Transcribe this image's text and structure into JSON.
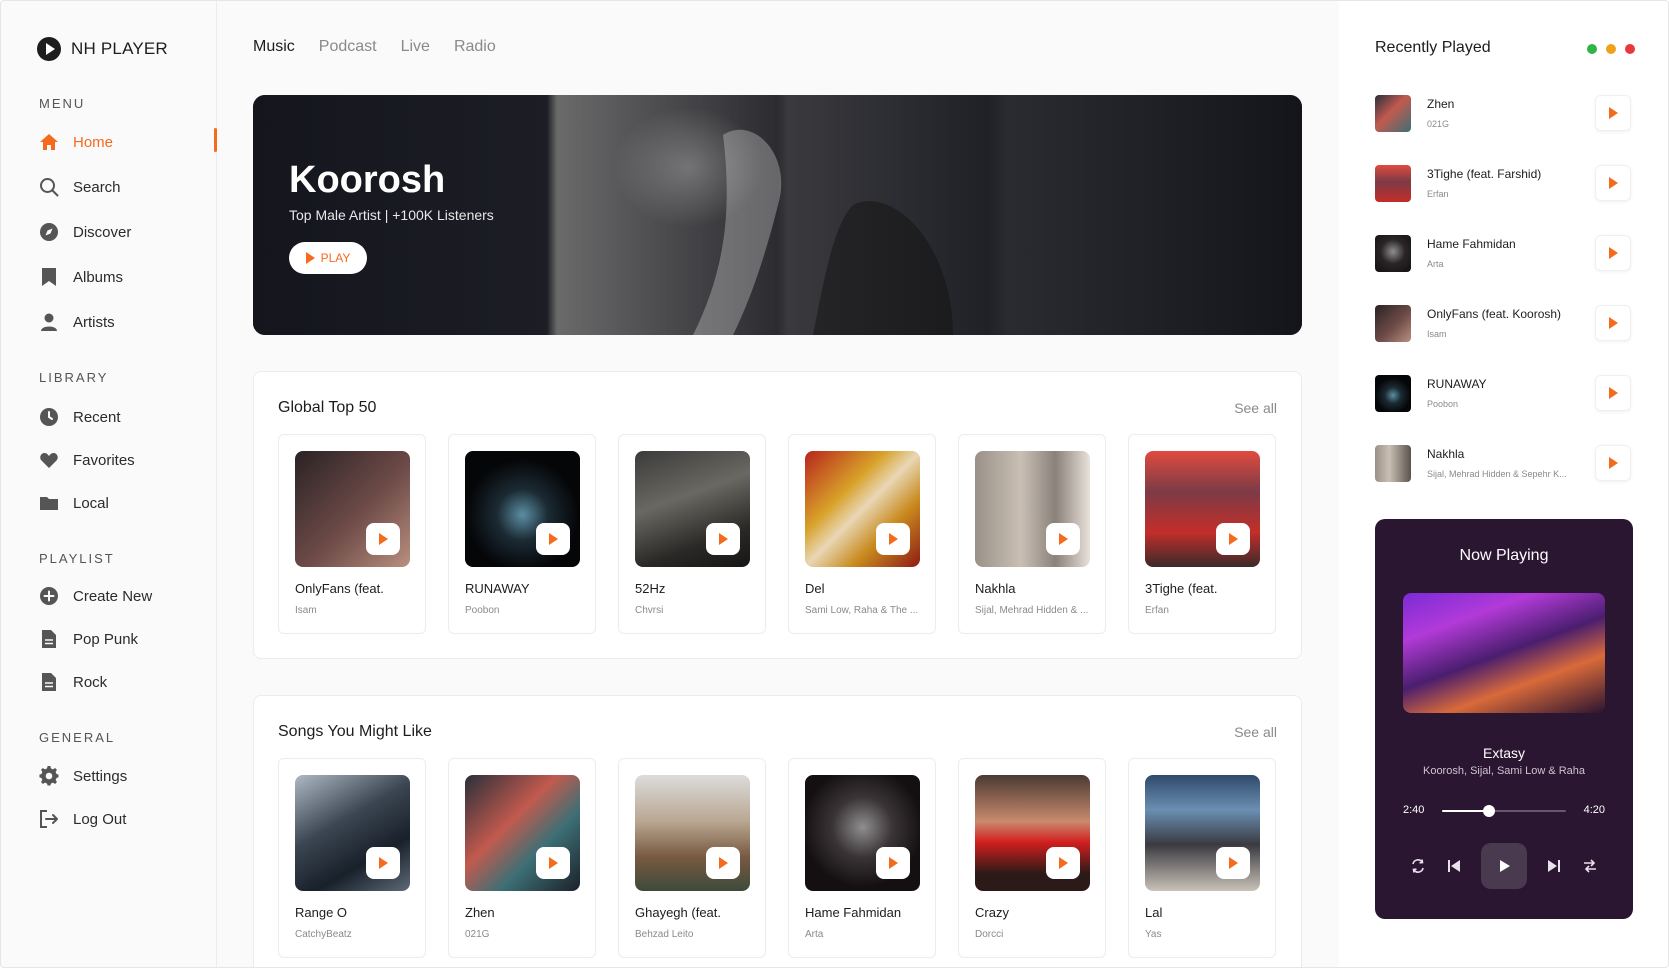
{
  "app": {
    "name": "NH PLAYER"
  },
  "sidebar": {
    "sections": {
      "menu": "MENU",
      "library": "LIBRARY",
      "playlist": "PLAYLIST",
      "general": "GENERAL"
    },
    "menu_items": [
      {
        "label": "Home",
        "icon": "home-icon",
        "active": true
      },
      {
        "label": "Search",
        "icon": "search-icon"
      },
      {
        "label": "Discover",
        "icon": "compass-icon"
      },
      {
        "label": "Albums",
        "icon": "bookmark-icon"
      },
      {
        "label": "Artists",
        "icon": "user-icon"
      }
    ],
    "library_items": [
      {
        "label": "Recent",
        "icon": "clock-icon"
      },
      {
        "label": "Favorites",
        "icon": "heart-icon"
      },
      {
        "label": "Local",
        "icon": "folder-icon"
      }
    ],
    "playlist_items": [
      {
        "label": "Create New",
        "icon": "plus-circle-icon"
      },
      {
        "label": "Pop Punk",
        "icon": "document-icon"
      },
      {
        "label": "Rock",
        "icon": "document-icon"
      }
    ],
    "general_items": [
      {
        "label": "Settings",
        "icon": "gear-icon"
      },
      {
        "label": "Log Out",
        "icon": "logout-icon"
      }
    ]
  },
  "header": {
    "tabs": [
      {
        "label": "Music",
        "active": true
      },
      {
        "label": "Podcast"
      },
      {
        "label": "Live"
      },
      {
        "label": "Radio"
      }
    ]
  },
  "hero": {
    "title": "Koorosh",
    "subtitle": "Top Male Artist | +100K Listeners",
    "play_label": "PLAY"
  },
  "global_top": {
    "title": "Global Top 50",
    "see_all": "See all",
    "items": [
      {
        "title": "OnlyFans (feat.",
        "artist": "Isam"
      },
      {
        "title": "RUNAWAY",
        "artist": "Poobon"
      },
      {
        "title": "52Hz",
        "artist": "Chvrsi"
      },
      {
        "title": "Del",
        "artist": "Sami Low, Raha & The ..."
      },
      {
        "title": "Nakhla",
        "artist": "Sijal, Mehrad Hidden & ..."
      },
      {
        "title": "3Tighe (feat.",
        "artist": "Erfan"
      }
    ]
  },
  "might_like": {
    "title": "Songs You Might Like",
    "see_all": "See all",
    "items": [
      {
        "title": "Range O",
        "artist": "CatchyBeatz"
      },
      {
        "title": "Zhen",
        "artist": "021G"
      },
      {
        "title": "Ghayegh (feat.",
        "artist": "Behzad Leito"
      },
      {
        "title": "Hame Fahmidan",
        "artist": "Arta"
      },
      {
        "title": "Crazy",
        "artist": "Dorcci"
      },
      {
        "title": "Lal",
        "artist": "Yas"
      }
    ]
  },
  "recently_played": {
    "title": "Recently Played",
    "window_dots": [
      "#2fb44a",
      "#f0a11c",
      "#e8383d"
    ],
    "items": [
      {
        "title": "Zhen",
        "artist": "021G"
      },
      {
        "title": "3Tighe (feat. Farshid)",
        "artist": "Erfan"
      },
      {
        "title": "Hame Fahmidan",
        "artist": "Arta"
      },
      {
        "title": "OnlyFans (feat. Koorosh)",
        "artist": "Isam"
      },
      {
        "title": "RUNAWAY",
        "artist": "Poobon"
      },
      {
        "title": "Nakhla",
        "artist": "Sijal, Mehrad Hidden & Sepehr K..."
      }
    ]
  },
  "now_playing": {
    "title": "Now Playing",
    "song": "Extasy",
    "artist": "Koorosh, Sijal, Sami Low & Raha",
    "time_current": "2:40",
    "time_total": "4:20",
    "progress": 0.38
  },
  "colors": {
    "accent": "#f46b1e",
    "now_playing_bg": "#2a1630"
  }
}
